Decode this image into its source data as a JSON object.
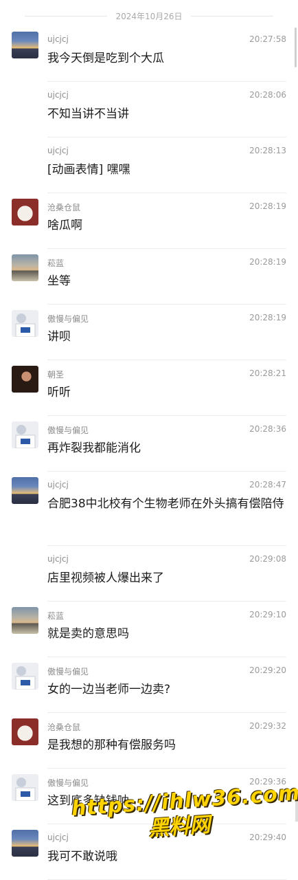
{
  "date_separator": "2024年10月26日",
  "messages": [
    {
      "name": "ujcjcj",
      "time": "20:27:58",
      "text": "我今天倒是吃到个大瓜",
      "avatar": "sunset-avatar"
    },
    {
      "name": "ujcjcj",
      "time": "20:28:06",
      "text": "不知当讲不当讲",
      "avatar": ""
    },
    {
      "name": "ujcjcj",
      "time": "20:28:13",
      "text": "[动画表情] 嘿嘿",
      "avatar": ""
    },
    {
      "name": "沧桑仓鼠",
      "time": "20:28:19",
      "text": "啥瓜啊",
      "avatar": "dog-avatar"
    },
    {
      "name": "菘蓝",
      "time": "20:28:19",
      "text": "坐等",
      "avatar": "cloud-avatar"
    },
    {
      "name": "傲慢与偏见",
      "time": "20:28:19",
      "text": "讲呗",
      "avatar": "person-avatar"
    },
    {
      "name": "朝圣",
      "time": "20:28:21",
      "text": "听听",
      "avatar": "dark-avatar"
    },
    {
      "name": "傲慢与偏见",
      "time": "20:28:36",
      "text": "再炸裂我都能消化",
      "avatar": "person-avatar"
    },
    {
      "name": "ujcjcj",
      "time": "20:28:47",
      "text": "合肥38中北校有个生物老师在外头搞有偿陪侍",
      "avatar": "sunset-avatar"
    },
    {
      "name": "ujcjcj",
      "time": "20:29:08",
      "text": "店里视频被人爆出来了",
      "avatar": ""
    },
    {
      "name": "菘蓝",
      "time": "20:29:10",
      "text": "就是卖的意思吗",
      "avatar": "cloud-avatar"
    },
    {
      "name": "傲慢与偏见",
      "time": "20:29:20",
      "text": "女的一边当老师一边卖?",
      "avatar": "person-avatar"
    },
    {
      "name": "沧桑仓鼠",
      "time": "20:29:32",
      "text": "是我想的那种有偿服务吗",
      "avatar": "dog-avatar"
    },
    {
      "name": "傲慢与偏见",
      "time": "20:29:36",
      "text": "这到底多缺钱呐",
      "avatar": "person-avatar"
    },
    {
      "name": "ujcjcj",
      "time": "20:29:40",
      "text": "我可不敢说哦",
      "avatar": "sunset-avatar"
    }
  ],
  "watermark": {
    "url": "https://ihlw36.com",
    "sub": "黑料网"
  }
}
